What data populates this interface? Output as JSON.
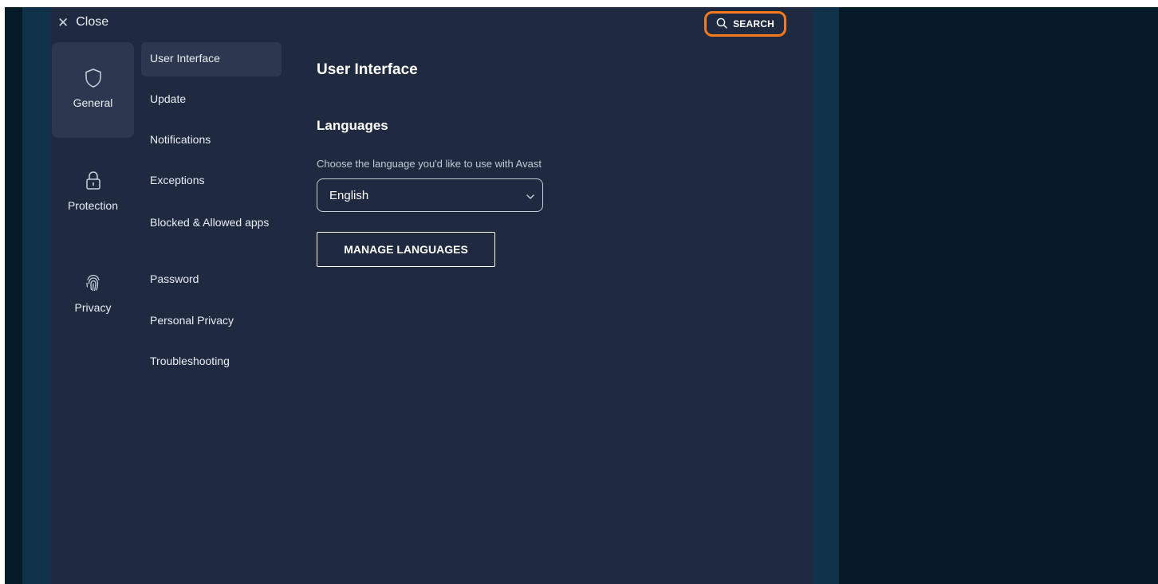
{
  "header": {
    "close_label": "Close",
    "search_label": "SEARCH"
  },
  "categories": [
    {
      "label": "General",
      "icon": "shield-icon",
      "active": true
    },
    {
      "label": "Protection",
      "icon": "lock-icon",
      "active": false
    },
    {
      "label": "Privacy",
      "icon": "fingerprint-icon",
      "active": false
    }
  ],
  "subnav": {
    "items": [
      {
        "label": "User Interface",
        "active": true
      },
      {
        "label": "Update"
      },
      {
        "label": "Notifications"
      },
      {
        "label": "Exceptions"
      },
      {
        "label": "Blocked & Allowed apps"
      },
      {
        "label": "Password"
      },
      {
        "label": "Personal Privacy"
      },
      {
        "label": "Troubleshooting"
      }
    ]
  },
  "content": {
    "title": "User Interface",
    "section_title": "Languages",
    "language_description": "Choose the language you'd like to use with Avast",
    "language_selected": "English",
    "manage_button_label": "MANAGE LANGUAGES"
  },
  "colors": {
    "panel": "#1f2a40",
    "active_item": "#2d3850",
    "highlight": "#f57a1c",
    "backdrop": "#10314a",
    "outer": "#061a27"
  }
}
